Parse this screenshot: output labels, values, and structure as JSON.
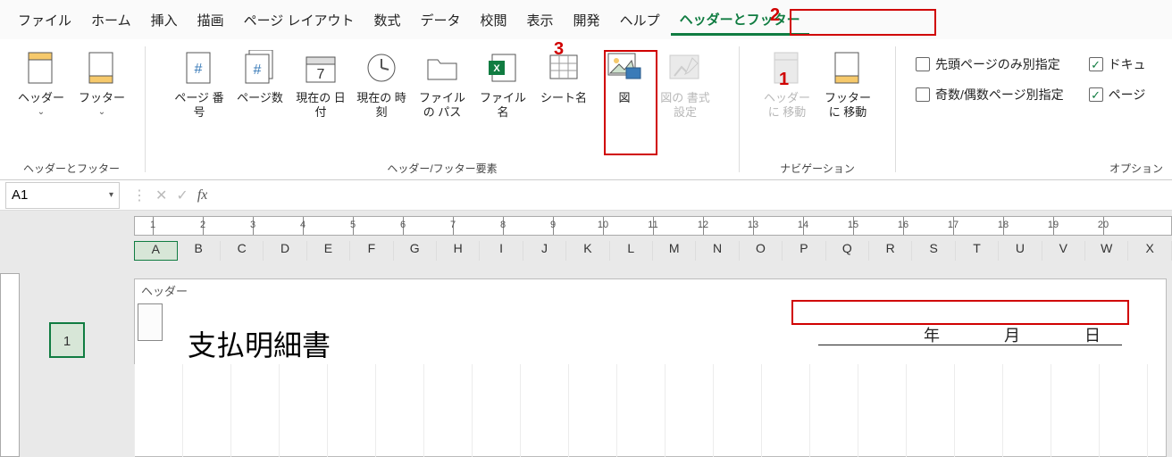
{
  "menu": [
    "ファイル",
    "ホーム",
    "挿入",
    "描画",
    "ページ レイアウト",
    "数式",
    "データ",
    "校閲",
    "表示",
    "開発",
    "ヘルプ",
    "ヘッダーとフッター"
  ],
  "menu_active_index": 11,
  "ribbon": {
    "group1": {
      "label": "ヘッダーとフッター",
      "header_btn": "ヘッダー",
      "footer_btn": "フッター"
    },
    "group2": {
      "label": "ヘッダー/フッター要素",
      "page_num": "ページ\n番号",
      "page_count": "ページ数",
      "cur_date": "現在の\n日付",
      "cur_time": "現在の\n時刻",
      "file_path": "ファイルの\nパス",
      "file_name": "ファイル名",
      "sheet_name": "シート名",
      "picture": "図",
      "pic_fmt": "図の\n書式設定"
    },
    "group3": {
      "label": "ナビゲーション",
      "goto_header": "ヘッダーに\n移動",
      "goto_footer": "フッターに\n移動"
    },
    "options": {
      "label": "オプション",
      "first_diff": "先頭ページのみ別指定",
      "odd_even": "奇数/偶数ページ別指定",
      "doc_text": "ドキュ",
      "page_text": "ページ",
      "first_diff_checked": false,
      "odd_even_checked": false,
      "doc_checked": true,
      "page_checked": true
    }
  },
  "namebox": "A1",
  "fx_label": "fx",
  "formula_value": "",
  "ruler_numbers": [
    1,
    2,
    3,
    4,
    5,
    6,
    7,
    8,
    9,
    10,
    11,
    12,
    13,
    14,
    15,
    16,
    17,
    18,
    19,
    20
  ],
  "columns": [
    "A",
    "B",
    "C",
    "D",
    "E",
    "F",
    "G",
    "H",
    "I",
    "J",
    "K",
    "L",
    "M",
    "N",
    "O",
    "P",
    "Q",
    "R",
    "S",
    "T",
    "U",
    "V",
    "W",
    "X"
  ],
  "selected_col_index": 0,
  "row1": "1",
  "sheet": {
    "header_area_label": "ヘッダー",
    "title": "支払明細書",
    "date_labels": {
      "year": "年",
      "month": "月",
      "day": "日"
    }
  },
  "callouts": {
    "one": "1",
    "two": "2",
    "three": "3"
  }
}
